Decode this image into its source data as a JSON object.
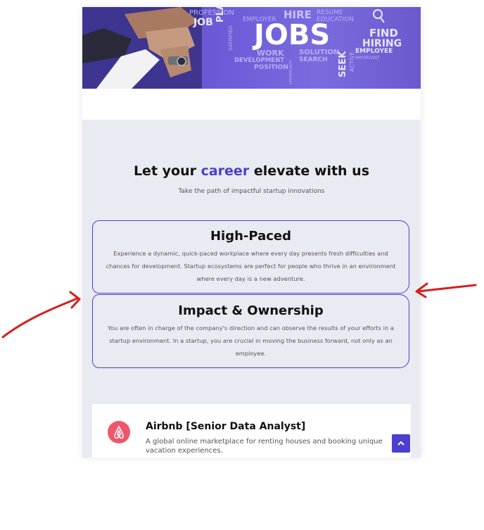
{
  "hero": {
    "main_word": "JOBS",
    "words": [
      "PROFESSION",
      "JOB",
      "PLAN",
      "SATISFIED",
      "EMPLOYER",
      "HIRE",
      "RESUME",
      "EDUCATION",
      "FIND",
      "HIRING",
      "EMPLOYEE",
      "WORK",
      "SOLUTION",
      "DEVELOPMENT",
      "SEARCH",
      "POSITION",
      "SEEK",
      "ACTIVE",
      "IMPORTANT",
      "OPPORTUNITY"
    ]
  },
  "career": {
    "heading_prefix": "Let your ",
    "heading_accent": "career",
    "heading_suffix": " elevate with us",
    "subheading": "Take the path of impactful startup innovations"
  },
  "cards": [
    {
      "title": "High-Paced",
      "text": "Experience a dynamic, quick-paced workplace where every day presents fresh difficulties and chances for development. Startup ecosystems are perfect for people who thrive in an environment where every day is a new adventure."
    },
    {
      "title": "Impact & Ownership",
      "text": "You are often in charge of the company's direction and can observe the results of your efforts in a startup environment. In a startup, you are crucial in moving the business forward, not only as an employee."
    }
  ],
  "job": {
    "title": "Airbnb [Senior Data Analyst]",
    "description": "A global online marketplace for renting houses and booking unique vacation experiences.",
    "logo_icon": "airbnb-logo-icon"
  },
  "icons": {
    "scroll_top": "chevron-up-icon"
  },
  "colors": {
    "accent": "#4a3fd0",
    "section_bg": "#e9ebf3",
    "logo": "#f0566a",
    "annotation": "#d42020"
  }
}
